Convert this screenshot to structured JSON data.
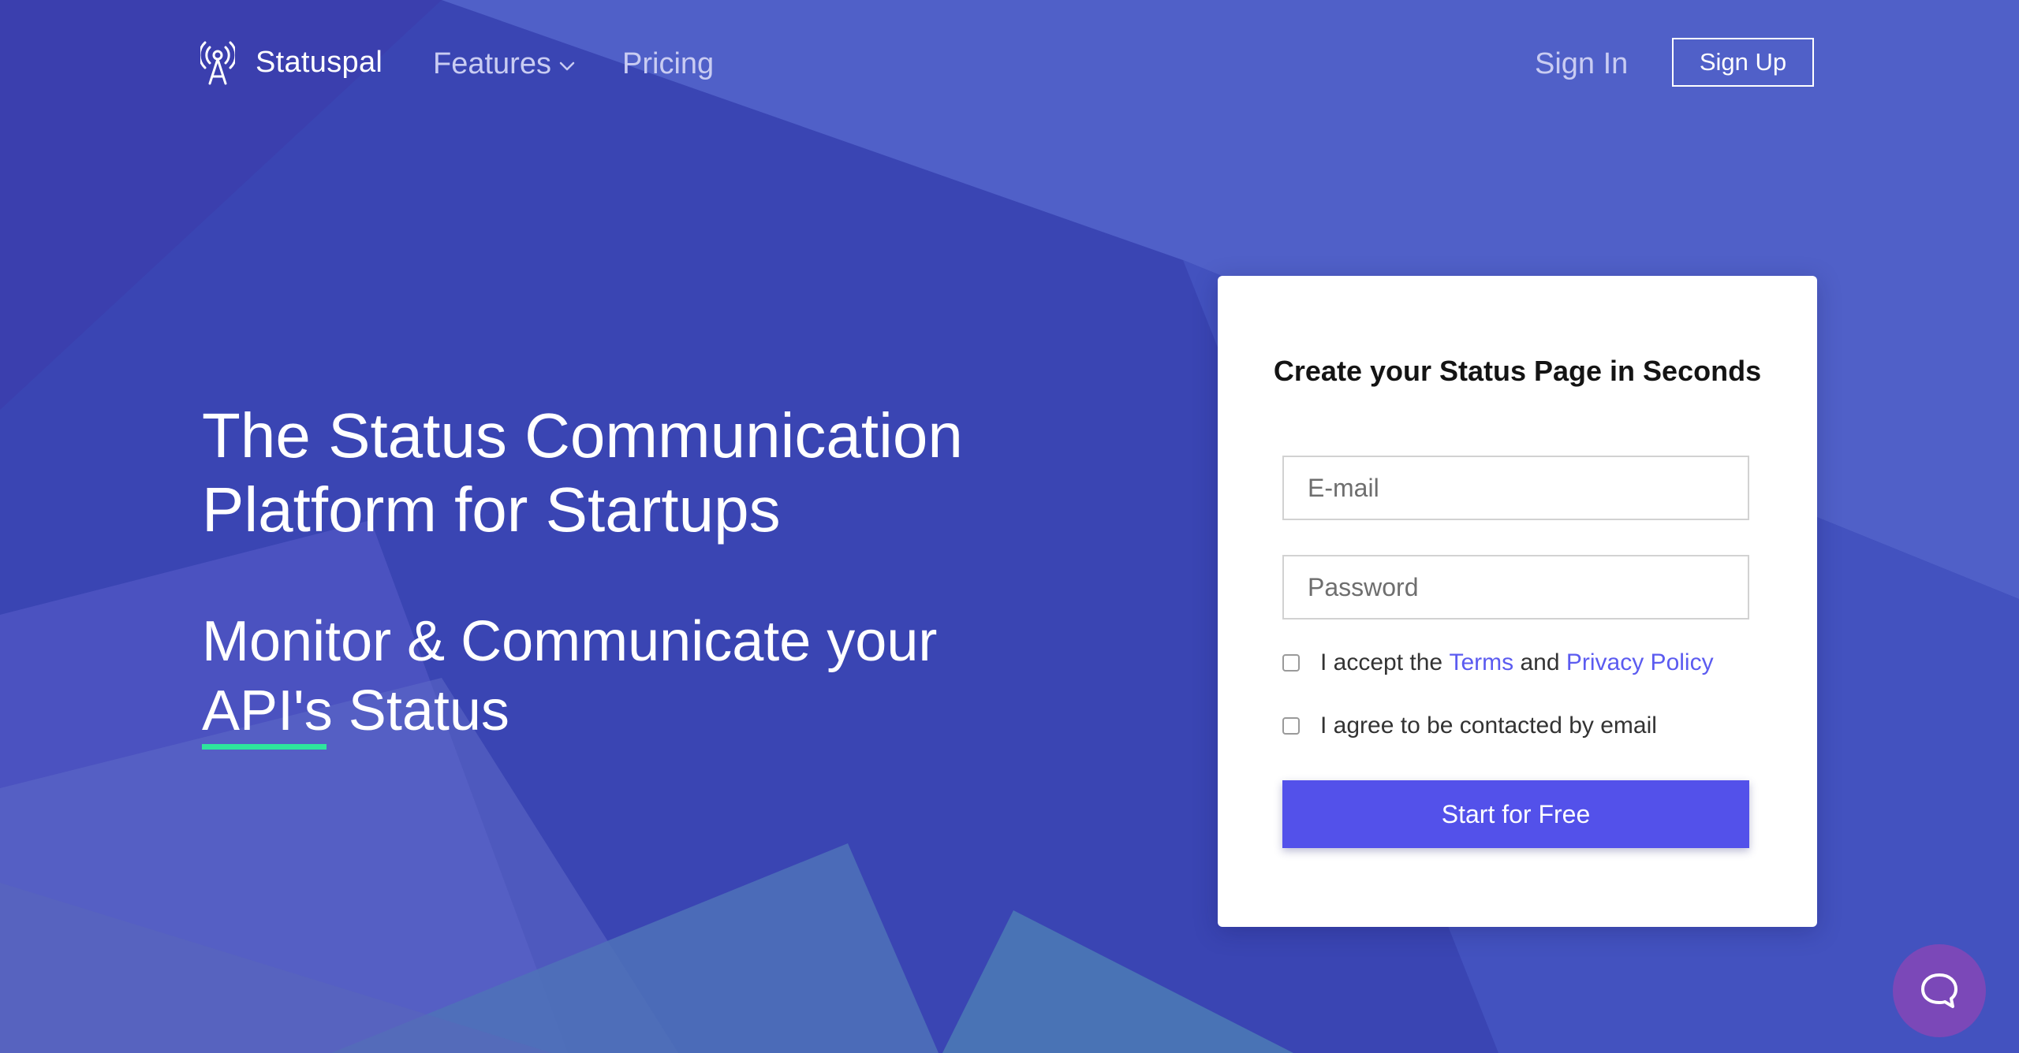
{
  "nav": {
    "brand": "Statuspal",
    "features": "Features",
    "pricing": "Pricing",
    "sign_in": "Sign In",
    "sign_up": "Sign Up"
  },
  "hero": {
    "title_line1": "The Status Communication",
    "title_line2": "Platform for Startups",
    "subtitle_line1": "Monitor & Communicate your",
    "subtitle_line2": "API's Status"
  },
  "signup_card": {
    "title": "Create your Status Page in Seconds",
    "email_placeholder": "E-mail",
    "password_placeholder": "Password",
    "terms_prefix": "I accept the",
    "terms_link": "Terms",
    "terms_and": "and",
    "privacy_link": "Privacy Policy",
    "contact_consent": "I agree to be contacted by email",
    "submit": "Start for Free"
  },
  "icons": {
    "logo": "radio-tower-icon",
    "features_chevron": "chevron-down-icon",
    "chat": "chat-bubble-icon"
  },
  "colors": {
    "background": "#3a45b3",
    "accent_button": "#5351ea",
    "link": "#5b5bf0",
    "underline": "#2ee59d",
    "chat_bubble": "#7b48b8"
  }
}
